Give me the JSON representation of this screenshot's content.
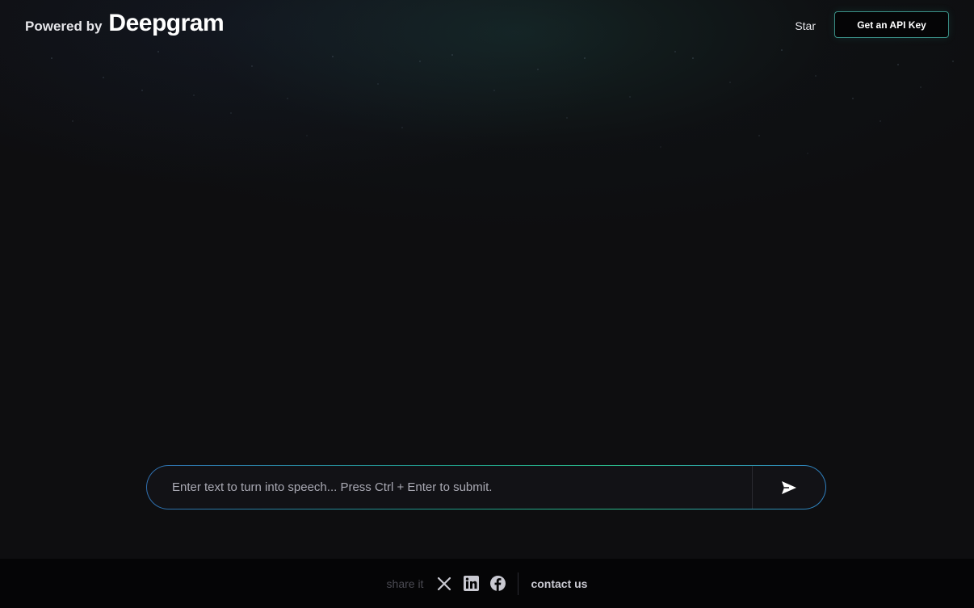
{
  "header": {
    "brand_prefix": "Powered by",
    "brand_name": "Deepgram",
    "star_label": "Star",
    "api_button_label": "Get an API Key"
  },
  "composer": {
    "placeholder": "Enter text to turn into speech... Press Ctrl + Enter to submit.",
    "value": "",
    "send_icon": "send-icon"
  },
  "footer": {
    "share_label": "share it",
    "social_icons": [
      "x-icon",
      "linkedin-icon",
      "facebook-icon"
    ],
    "contact_label": "contact us"
  },
  "colors": {
    "background": "#0e0e10",
    "footer_background": "#050506",
    "accent_green": "#2bb98a",
    "accent_blue": "#2f6fb0"
  }
}
